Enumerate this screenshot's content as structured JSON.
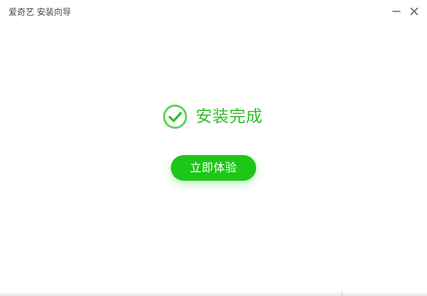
{
  "window": {
    "title": "爱奇艺 安装向导"
  },
  "status": {
    "message": "安装完成",
    "icon": "check-circle-icon"
  },
  "actions": {
    "primary_label": "立即体验"
  },
  "colors": {
    "accent": "#1ec61a",
    "status_text": "#2fbf27",
    "check_ring": "#5bd65a"
  }
}
